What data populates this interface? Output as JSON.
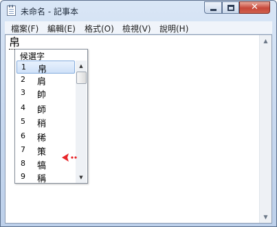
{
  "window": {
    "title": "未命名 - 記事本"
  },
  "menu": [
    "檔案(F)",
    "編輯(E)",
    "格式(O)",
    "檢視(V)",
    "說明(H)"
  ],
  "editor": {
    "composing_text": "帛"
  },
  "candidate_window": {
    "title": "候選字",
    "items": [
      {
        "num": "1",
        "char": "帛"
      },
      {
        "num": "2",
        "char": "肩"
      },
      {
        "num": "3",
        "char": "帥"
      },
      {
        "num": "4",
        "char": "師"
      },
      {
        "num": "5",
        "char": "稍"
      },
      {
        "num": "6",
        "char": "稀"
      },
      {
        "num": "7",
        "char": "策"
      },
      {
        "num": "8",
        "char": "犒"
      },
      {
        "num": "9",
        "char": "稱"
      }
    ],
    "selected_index": 0
  },
  "colors": {
    "pointer_arrow": "#e8262a",
    "selection": "#cfe1f8"
  }
}
